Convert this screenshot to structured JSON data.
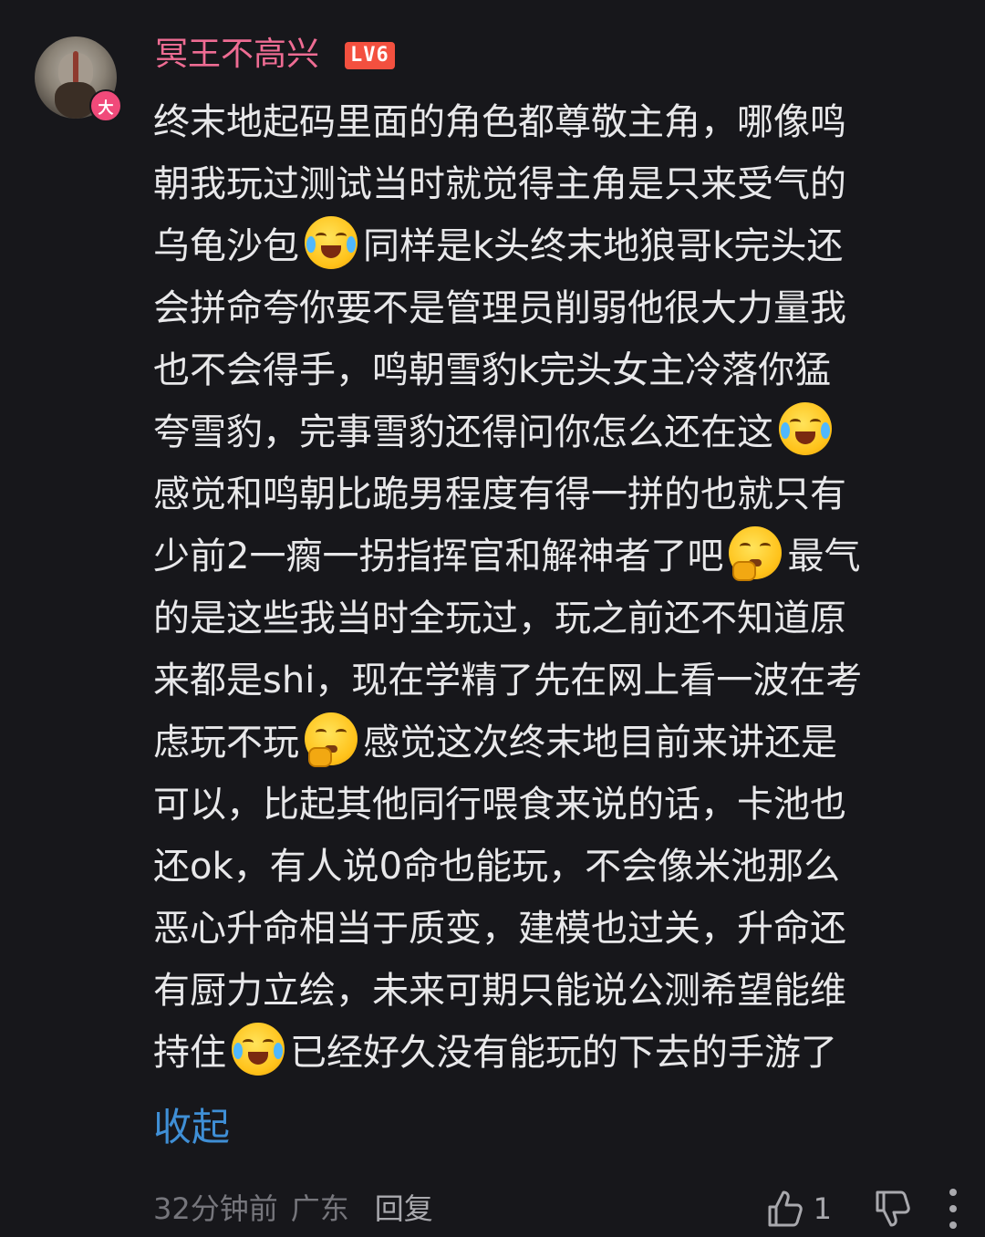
{
  "user": {
    "name": "冥王不高兴",
    "level": "LV6",
    "badge": "大"
  },
  "comment": {
    "lines": [
      {
        "pre": "终末地起码里面的角色都尊敬主角，哪像鸣",
        "emoji": "",
        "post": ""
      },
      {
        "pre": "朝我玩过测试当时就觉得主角是只来受气的",
        "emoji": "",
        "post": ""
      },
      {
        "pre": "乌龟沙包",
        "emoji": "crying-laughing",
        "post": "同样是k头终末地狼哥k完头还"
      },
      {
        "pre": "会拼命夸你要不是管理员削弱他很大力量我",
        "emoji": "",
        "post": ""
      },
      {
        "pre": "也不会得手，鸣朝雪豹k完头女主冷落你猛",
        "emoji": "",
        "post": ""
      },
      {
        "pre": "夸雪豹，完事雪豹还得问你怎么还在这",
        "emoji": "tears-of-joy",
        "post": ""
      },
      {
        "pre": "感觉和鸣朝比跪男程度有得一拼的也就只有",
        "emoji": "",
        "post": ""
      },
      {
        "pre": "少前2一瘸一拐指挥官和解神者了吧",
        "emoji": "thinking",
        "post": "最气"
      },
      {
        "pre": "的是这些我当时全玩过，玩之前还不知道原",
        "emoji": "",
        "post": ""
      },
      {
        "pre": "来都是shi，现在学精了先在网上看一波在考",
        "emoji": "",
        "post": ""
      },
      {
        "pre": "虑玩不玩",
        "emoji": "thinking",
        "post": "感觉这次终末地目前来讲还是"
      },
      {
        "pre": "可以，比起其他同行喂食来说的话，卡池也",
        "emoji": "",
        "post": ""
      },
      {
        "pre": "还ok，有人说0命也能玩，不会像米池那么",
        "emoji": "",
        "post": ""
      },
      {
        "pre": "恶心升命相当于质变，建模也过关，升命还",
        "emoji": "",
        "post": ""
      },
      {
        "pre": "有厨力立绘，未来可期只能说公测希望能维",
        "emoji": "",
        "post": ""
      },
      {
        "pre": "持住",
        "emoji": "crying-laughing",
        "post": "已经好久没有能玩的下去的手游了"
      }
    ],
    "collapse_label": "收起"
  },
  "footer": {
    "time": "32分钟前",
    "location": "广东",
    "reply_label": "回复",
    "like_count": "1"
  },
  "colors": {
    "background": "#17171b",
    "username": "#ee6c93",
    "level_badge": "#f3503f",
    "link": "#3f8fd6"
  },
  "icons": [
    "avatar",
    "thumbs-up-icon",
    "thumbs-down-icon",
    "more-icon"
  ]
}
